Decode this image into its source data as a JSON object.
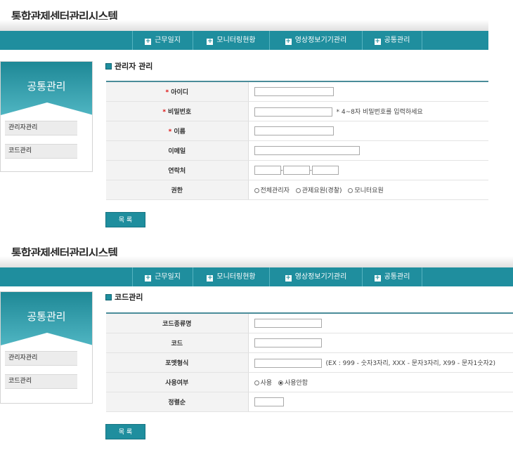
{
  "app_title": "통합관제센터관리시스템",
  "nav": [
    "근무일지",
    "모니터링현황",
    "영상정보기기관리",
    "공통관리"
  ],
  "sidebar": {
    "title": "공통관리",
    "items": [
      "관리자관리",
      "코드관리"
    ]
  },
  "icons": {
    "nav_plus": "plus-icon",
    "section": "square-bullet-icon",
    "required": "asterisk-icon"
  },
  "colors": {
    "accent": "#1f8e9e"
  },
  "admin_form": {
    "section_title": "관리자 관리",
    "required_mark": "*",
    "fields": {
      "id": {
        "label": "아이디",
        "value": ""
      },
      "password": {
        "label": "비밀번호",
        "value": "",
        "hint": "* 4~8자 비밀번호를 입력하세요"
      },
      "name": {
        "label": "이름",
        "value": ""
      },
      "email": {
        "label": "이메일",
        "value": ""
      },
      "phone": {
        "label": "연락처",
        "part1": "",
        "part2": "",
        "part3": "",
        "separator": "-"
      },
      "role": {
        "label": "권한",
        "options": [
          "전체관리자",
          "관제요원(경찰)",
          "모니터요원"
        ]
      }
    },
    "list_button": "목 록"
  },
  "code_form": {
    "section_title": "코드관리",
    "fields": {
      "code_type": {
        "label": "코드종류명",
        "value": ""
      },
      "code": {
        "label": "코드",
        "value": ""
      },
      "format": {
        "label": "포멧형식",
        "value": "",
        "hint": "(EX : 999 - 숫자3자리, XXX - 문자3자리, X99 - 문자1숫자2)"
      },
      "use": {
        "label": "사용여부",
        "options": [
          "사용",
          "사용안함"
        ],
        "selected": "사용안함"
      },
      "order": {
        "label": "정렬순",
        "value": ""
      }
    },
    "list_button": "목 록"
  }
}
